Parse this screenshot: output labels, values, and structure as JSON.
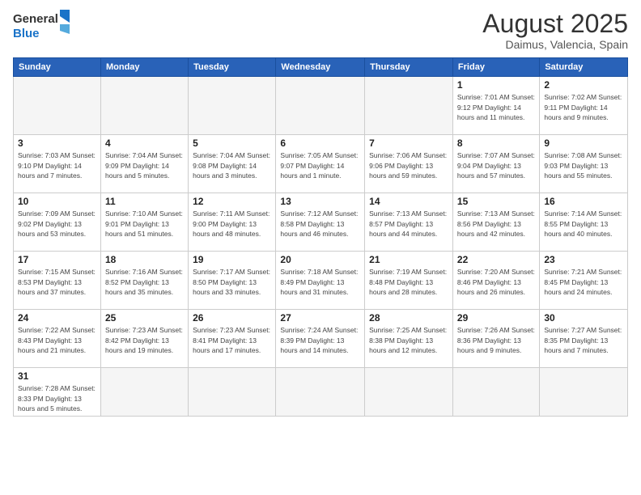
{
  "logo": {
    "text_general": "General",
    "text_blue": "Blue"
  },
  "title": "August 2025",
  "location": "Daimus, Valencia, Spain",
  "weekdays": [
    "Sunday",
    "Monday",
    "Tuesday",
    "Wednesday",
    "Thursday",
    "Friday",
    "Saturday"
  ],
  "rows": [
    [
      {
        "day": "",
        "info": ""
      },
      {
        "day": "",
        "info": ""
      },
      {
        "day": "",
        "info": ""
      },
      {
        "day": "",
        "info": ""
      },
      {
        "day": "",
        "info": ""
      },
      {
        "day": "1",
        "info": "Sunrise: 7:01 AM\nSunset: 9:12 PM\nDaylight: 14 hours\nand 11 minutes."
      },
      {
        "day": "2",
        "info": "Sunrise: 7:02 AM\nSunset: 9:11 PM\nDaylight: 14 hours\nand 9 minutes."
      }
    ],
    [
      {
        "day": "3",
        "info": "Sunrise: 7:03 AM\nSunset: 9:10 PM\nDaylight: 14 hours\nand 7 minutes."
      },
      {
        "day": "4",
        "info": "Sunrise: 7:04 AM\nSunset: 9:09 PM\nDaylight: 14 hours\nand 5 minutes."
      },
      {
        "day": "5",
        "info": "Sunrise: 7:04 AM\nSunset: 9:08 PM\nDaylight: 14 hours\nand 3 minutes."
      },
      {
        "day": "6",
        "info": "Sunrise: 7:05 AM\nSunset: 9:07 PM\nDaylight: 14 hours\nand 1 minute."
      },
      {
        "day": "7",
        "info": "Sunrise: 7:06 AM\nSunset: 9:06 PM\nDaylight: 13 hours\nand 59 minutes."
      },
      {
        "day": "8",
        "info": "Sunrise: 7:07 AM\nSunset: 9:04 PM\nDaylight: 13 hours\nand 57 minutes."
      },
      {
        "day": "9",
        "info": "Sunrise: 7:08 AM\nSunset: 9:03 PM\nDaylight: 13 hours\nand 55 minutes."
      }
    ],
    [
      {
        "day": "10",
        "info": "Sunrise: 7:09 AM\nSunset: 9:02 PM\nDaylight: 13 hours\nand 53 minutes."
      },
      {
        "day": "11",
        "info": "Sunrise: 7:10 AM\nSunset: 9:01 PM\nDaylight: 13 hours\nand 51 minutes."
      },
      {
        "day": "12",
        "info": "Sunrise: 7:11 AM\nSunset: 9:00 PM\nDaylight: 13 hours\nand 48 minutes."
      },
      {
        "day": "13",
        "info": "Sunrise: 7:12 AM\nSunset: 8:58 PM\nDaylight: 13 hours\nand 46 minutes."
      },
      {
        "day": "14",
        "info": "Sunrise: 7:13 AM\nSunset: 8:57 PM\nDaylight: 13 hours\nand 44 minutes."
      },
      {
        "day": "15",
        "info": "Sunrise: 7:13 AM\nSunset: 8:56 PM\nDaylight: 13 hours\nand 42 minutes."
      },
      {
        "day": "16",
        "info": "Sunrise: 7:14 AM\nSunset: 8:55 PM\nDaylight: 13 hours\nand 40 minutes."
      }
    ],
    [
      {
        "day": "17",
        "info": "Sunrise: 7:15 AM\nSunset: 8:53 PM\nDaylight: 13 hours\nand 37 minutes."
      },
      {
        "day": "18",
        "info": "Sunrise: 7:16 AM\nSunset: 8:52 PM\nDaylight: 13 hours\nand 35 minutes."
      },
      {
        "day": "19",
        "info": "Sunrise: 7:17 AM\nSunset: 8:50 PM\nDaylight: 13 hours\nand 33 minutes."
      },
      {
        "day": "20",
        "info": "Sunrise: 7:18 AM\nSunset: 8:49 PM\nDaylight: 13 hours\nand 31 minutes."
      },
      {
        "day": "21",
        "info": "Sunrise: 7:19 AM\nSunset: 8:48 PM\nDaylight: 13 hours\nand 28 minutes."
      },
      {
        "day": "22",
        "info": "Sunrise: 7:20 AM\nSunset: 8:46 PM\nDaylight: 13 hours\nand 26 minutes."
      },
      {
        "day": "23",
        "info": "Sunrise: 7:21 AM\nSunset: 8:45 PM\nDaylight: 13 hours\nand 24 minutes."
      }
    ],
    [
      {
        "day": "24",
        "info": "Sunrise: 7:22 AM\nSunset: 8:43 PM\nDaylight: 13 hours\nand 21 minutes."
      },
      {
        "day": "25",
        "info": "Sunrise: 7:23 AM\nSunset: 8:42 PM\nDaylight: 13 hours\nand 19 minutes."
      },
      {
        "day": "26",
        "info": "Sunrise: 7:23 AM\nSunset: 8:41 PM\nDaylight: 13 hours\nand 17 minutes."
      },
      {
        "day": "27",
        "info": "Sunrise: 7:24 AM\nSunset: 8:39 PM\nDaylight: 13 hours\nand 14 minutes."
      },
      {
        "day": "28",
        "info": "Sunrise: 7:25 AM\nSunset: 8:38 PM\nDaylight: 13 hours\nand 12 minutes."
      },
      {
        "day": "29",
        "info": "Sunrise: 7:26 AM\nSunset: 8:36 PM\nDaylight: 13 hours\nand 9 minutes."
      },
      {
        "day": "30",
        "info": "Sunrise: 7:27 AM\nSunset: 8:35 PM\nDaylight: 13 hours\nand 7 minutes."
      }
    ],
    [
      {
        "day": "31",
        "info": "Sunrise: 7:28 AM\nSunset: 8:33 PM\nDaylight: 13 hours\nand 5 minutes."
      },
      {
        "day": "",
        "info": ""
      },
      {
        "day": "",
        "info": ""
      },
      {
        "day": "",
        "info": ""
      },
      {
        "day": "",
        "info": ""
      },
      {
        "day": "",
        "info": ""
      },
      {
        "day": "",
        "info": ""
      }
    ]
  ]
}
